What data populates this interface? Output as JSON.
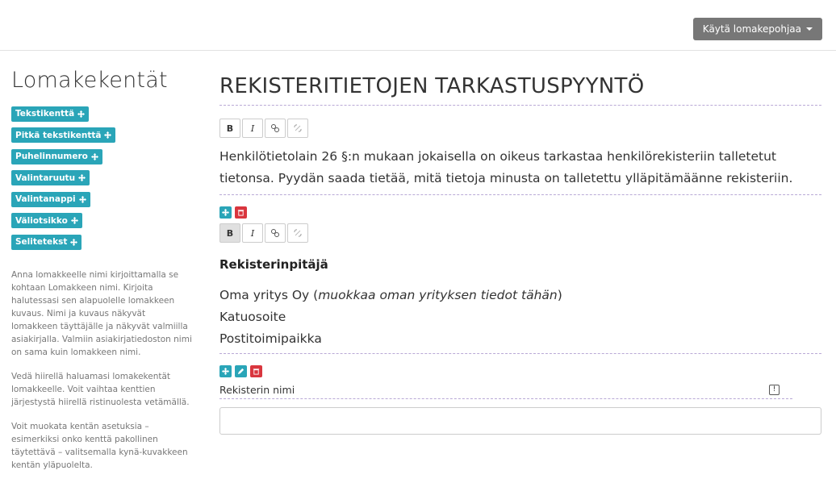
{
  "toolbar": {
    "use_template_label": "Käytä lomakepohjaa"
  },
  "sidebar": {
    "heading": "Lomakekentät",
    "chips": [
      {
        "label": "Tekstikenttä"
      },
      {
        "label": "Pitkä tekstikenttä"
      },
      {
        "label": "Puhelinnumero"
      },
      {
        "label": "Valintaruutu"
      },
      {
        "label": "Valintanappi"
      },
      {
        "label": "Väliotsikko"
      },
      {
        "label": "Selitetekst"
      }
    ],
    "help": [
      "Anna lomakkeelle nimi kirjoittamalla se kohtaan Lomakkeen nimi. Kirjoita halutessasi sen alapuolelle lomakkeen kuvaus. Nimi ja kuvaus näkyvät lomakkeen täyttäjälle ja näkyvät valmiilla asiakirjalla. Valmiin asiakirjatiedoston nimi on sama kuin lomakkeen nimi.",
      "Vedä hiirellä haluamasi lomakekentät lomakkeelle. Voit vaihtaa kenttien järjestystä hiirellä ristinuolesta vetämällä.",
      "Voit muokata kentän asetuksia – esimerkiksi onko kenttä pakollinen täytettävä – valitsemalla kynä-kuvakkeen kentän yläpuolelta."
    ]
  },
  "editor": {
    "form_title": "REKISTERITIETOJEN TARKASTUSPYYNTÖ",
    "buttons": {
      "bold": "B",
      "italic": "I"
    },
    "description": "Henkilötietolain 26 §:n mukaan jokaisella on oikeus tarkastaa henkilörekisteriin talletetut tietonsa. Pyydän saada tietää, mitä tietoja minusta on talletettu ylläpitämäänne rekisteriin.",
    "section_title": "Rekisterinpitäjä",
    "company_prefix": "Oma yritys Oy (",
    "company_hint": "muokkaa oman yrityksen tiedot tähän",
    "company_suffix": ")",
    "address": "Katuosoite",
    "postal": "Postitoimipaikka",
    "field_label": "Rekisterin nimi",
    "required_mark": "!"
  },
  "colors": {
    "accent": "#2aa5b8",
    "danger": "#d9363e",
    "button_gray": "#777777"
  }
}
